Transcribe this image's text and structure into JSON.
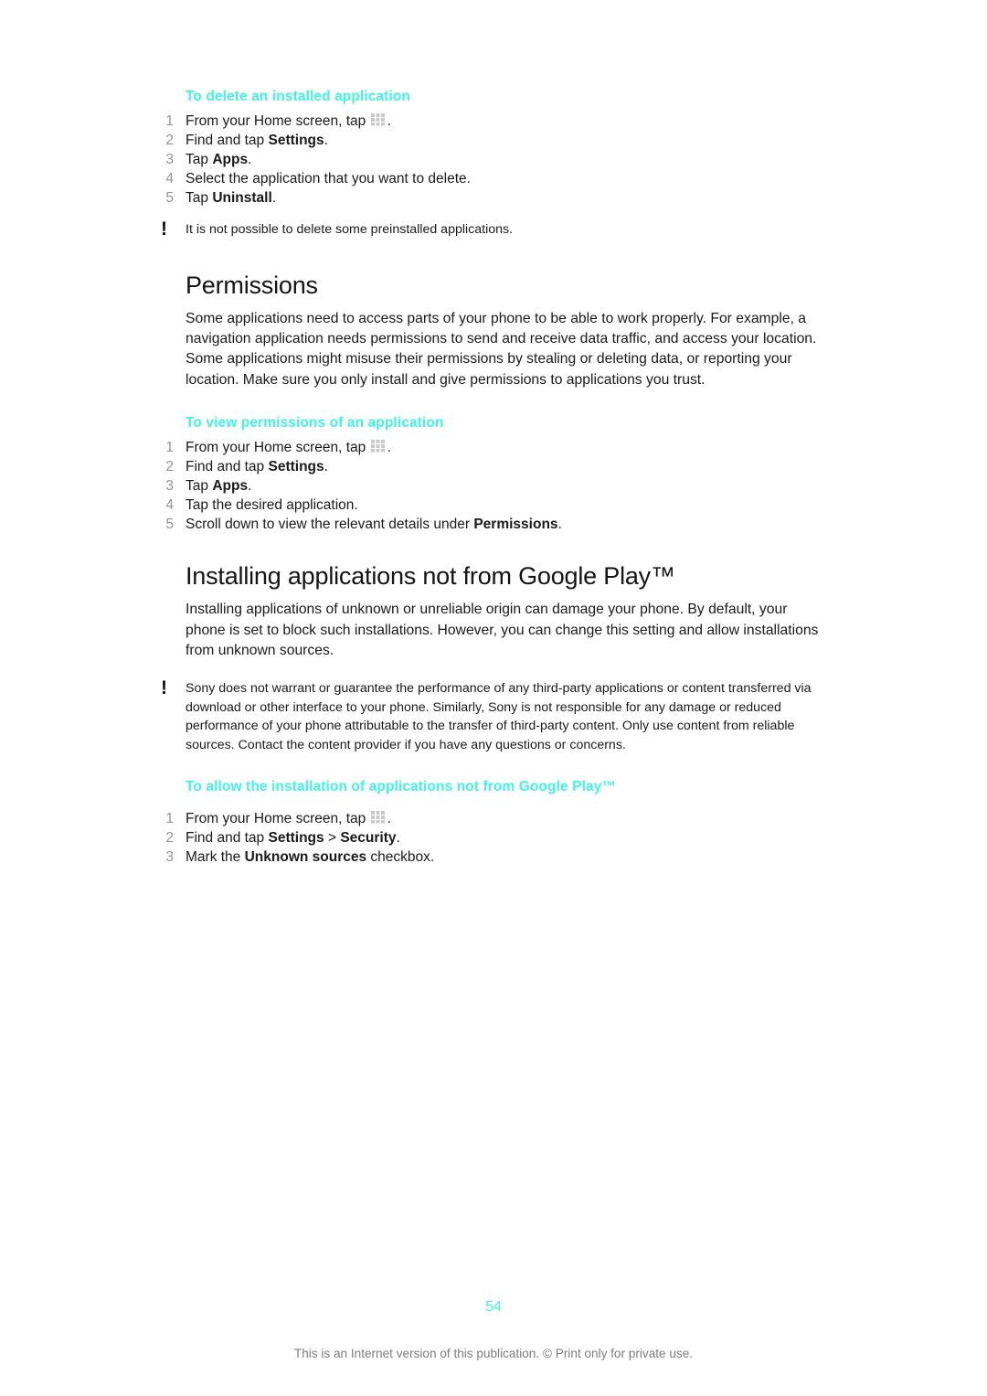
{
  "document": {
    "page_number": "54",
    "footer_note": "This is an Internet version of this publication. © Print only for private use.",
    "accent_color": "#3ff4e0",
    "number_color": "#949494"
  },
  "icons": {
    "app_drawer": "app-drawer-icon",
    "warning": "exclamation-icon",
    "warning_glyph": "!"
  },
  "sections": {
    "delete_app": {
      "heading": "To delete an installed application",
      "steps": [
        {
          "num": "1",
          "text_before": "From your Home screen, tap ",
          "icon": true,
          "text_after": "."
        },
        {
          "num": "2",
          "text_before": "Find and tap ",
          "bold": "Settings",
          "text_after": "."
        },
        {
          "num": "3",
          "text_before": "Tap ",
          "bold": "Apps",
          "text_after": "."
        },
        {
          "num": "4",
          "text_before": "Select the application that you want to delete.",
          "text_after": ""
        },
        {
          "num": "5",
          "text_before": "Tap ",
          "bold": "Uninstall",
          "text_after": "."
        }
      ],
      "note": "It is not possible to delete some preinstalled applications."
    },
    "permissions": {
      "heading": "Permissions",
      "body": "Some applications need to access parts of your phone to be able to work properly. For example, a navigation application needs permissions to send and receive data traffic, and access your location. Some applications might misuse their permissions by stealing or deleting data, or reporting your location. Make sure you only install and give permissions to applications you trust."
    },
    "view_permissions": {
      "heading": "To view permissions of an application",
      "steps": [
        {
          "num": "1",
          "text_before": "From your Home screen, tap ",
          "icon": true,
          "text_after": "."
        },
        {
          "num": "2",
          "text_before": "Find and tap ",
          "bold": "Settings",
          "text_after": "."
        },
        {
          "num": "3",
          "text_before": "Tap ",
          "bold": "Apps",
          "text_after": "."
        },
        {
          "num": "4",
          "text_before": "Tap the desired application.",
          "text_after": ""
        },
        {
          "num": "5",
          "text_before": "Scroll down to view the relevant details under ",
          "bold": "Permissions",
          "text_after": "."
        }
      ]
    },
    "installing_apps": {
      "heading": "Installing applications not from Google Play™",
      "body": "Installing applications of unknown or unreliable origin can damage your phone. By default, your phone is set to block such installations. However, you can change this setting and allow installations from unknown sources.",
      "note": "Sony does not warrant or guarantee the performance of any third-party applications or content transferred via download or other interface to your phone. Similarly, Sony is not responsible for any damage or reduced performance of your phone attributable to the transfer of third-party content. Only use content from reliable sources. Contact the content provider if you have any questions or concerns."
    },
    "allow_install": {
      "heading": "To allow the installation of applications not from Google Play™",
      "steps": [
        {
          "num": "1",
          "text_before": "From your Home screen, tap ",
          "icon": true,
          "text_after": "."
        },
        {
          "num": "2",
          "text_before": "Find and tap ",
          "bold": "Settings",
          "mid": " > ",
          "bold2": "Security",
          "text_after": "."
        },
        {
          "num": "3",
          "text_before": "Mark the ",
          "bold": "Unknown sources",
          "text_after": " checkbox."
        }
      ]
    }
  }
}
